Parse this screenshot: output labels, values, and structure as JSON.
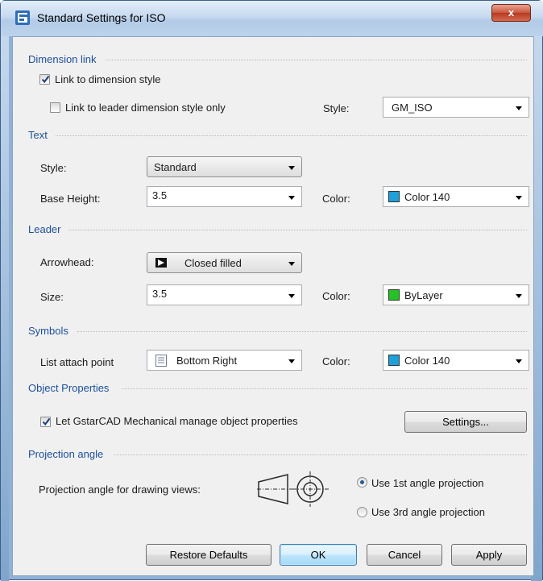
{
  "window": {
    "title": "Standard Settings for ISO",
    "close_label": "x"
  },
  "dimension_link": {
    "group_label": "Dimension link",
    "link_dim_style": {
      "label": "Link to dimension style",
      "checked": true
    },
    "link_leader_only": {
      "label": "Link to leader dimension style only",
      "checked": false
    },
    "style_label": "Style:",
    "style_value": "GM_ISO"
  },
  "text": {
    "group_label": "Text",
    "style_label": "Style:",
    "style_value": "Standard",
    "base_height_label": "Base Height:",
    "base_height_value": "3.5",
    "color_label": "Color:",
    "color_value": "Color 140",
    "color_swatch": "#1ea0d8"
  },
  "leader": {
    "group_label": "Leader",
    "arrowhead_label": "Arrowhead:",
    "arrowhead_value": "Closed filled",
    "arrowhead_icon": "closed-filled-arrow-icon",
    "size_label": "Size:",
    "size_value": "3.5",
    "color_label": "Color:",
    "color_value": "ByLayer",
    "color_swatch": "#22c322"
  },
  "symbols": {
    "group_label": "Symbols",
    "attach_label": "List attach point",
    "attach_value": "Bottom Right",
    "attach_icon": "list-icon",
    "color_label": "Color:",
    "color_value": "Color 140",
    "color_swatch": "#1ea0d8"
  },
  "object_properties": {
    "group_label": "Object Properties",
    "manage": {
      "label": "Let GstarCAD Mechanical manage object properties",
      "checked": true
    },
    "settings_button": "Settings..."
  },
  "projection": {
    "group_label": "Projection angle",
    "views_label": "Projection angle for drawing views:",
    "first_angle": {
      "label": "Use 1st angle projection",
      "selected": true
    },
    "third_angle": {
      "label": "Use 3rd angle projection",
      "selected": false
    }
  },
  "buttons": {
    "restore": "Restore Defaults",
    "ok": "OK",
    "cancel": "Cancel",
    "apply": "Apply"
  }
}
